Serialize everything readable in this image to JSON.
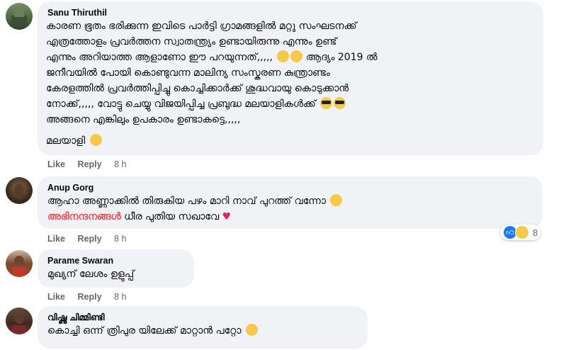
{
  "comments": [
    {
      "author": "Sanu Thiruthil",
      "lines": [
        "കാരണ ഭൂതം ഭരിക്കുന്ന ഇവിടെ പാർട്ടി ഗ്രാമങ്ങളിൽ മറ്റു സംഘടനക്ക്",
        "എത്രത്തോളം പ്രവർത്തന സ്വാതന്ത്ര്യം ഉണ്ടായിരുന്നു എന്നും ഉണ്ട്",
        "എന്നും അറിയാത്ത ആളാണോ ഈ പറയുന്നത്,,,,, ",
        " ആദ്യം 2019 ൽ",
        "ജനീവയിൽ പോയി കൊണ്ടുവന്ന മാലിന്യ സംസ്കരണ കുന്ത്രാണ്ടം",
        "കേരളത്തിൽ പ്രവർത്തിപ്പിച്ചു കൊച്ചിക്കാർക്ക് ശുദ്ധവായു കൊടുക്കാൻ",
        "നോക്ക്,,,,, വോട്ടു ചെയ്യു വിജയിപ്പിച്ച പ്രബുദ്ധ മലയാളികൾക്ക് ",
        "അങ്ങനെ എങ്കിലും ഉപകാരം ഉണ്ടാകട്ടെ,,,,,",
        "മലയാളി "
      ],
      "like": "Like",
      "reply": "Reply",
      "time": "8 h"
    },
    {
      "author": "Anup Gorg",
      "lines": [
        "ആഹാ അണ്ണാക്കിൽ തിരുകിയ പഴം മാറി നാവ് പുറത്ത് വന്നോ ",
        "അഭിനന്ദനങ്ങൾ",
        " ധീര പുതിയ സഖാവേ "
      ],
      "like": "Like",
      "reply": "Reply",
      "time": "8 h",
      "reaction_count": "8"
    },
    {
      "author": "Parame Swaran",
      "lines": [
        "മുഖ്യന് ലേശം ഉളുപ്പ്"
      ],
      "like": "Like",
      "reply": "Reply",
      "time": "8 h"
    },
    {
      "author": "വിഷ്ണു ചിമ്മിണ്ടി",
      "lines": [
        "കൊച്ചി ഒന്ന് ത്രിപുര യിലേക്ക് മാറ്റാൻ പറ്റോ "
      ]
    }
  ],
  "colors": {
    "bubble": "#f0f2f5",
    "highlight": "#e4525a",
    "meta": "#65676b",
    "like_blue": "#1877f2"
  },
  "icons": [
    "smile-emoji",
    "sunglasses-emoji",
    "laughing-emoji",
    "heart-eyes-emoji",
    "heart-icon",
    "like-reaction-icon",
    "haha-reaction-icon"
  ]
}
